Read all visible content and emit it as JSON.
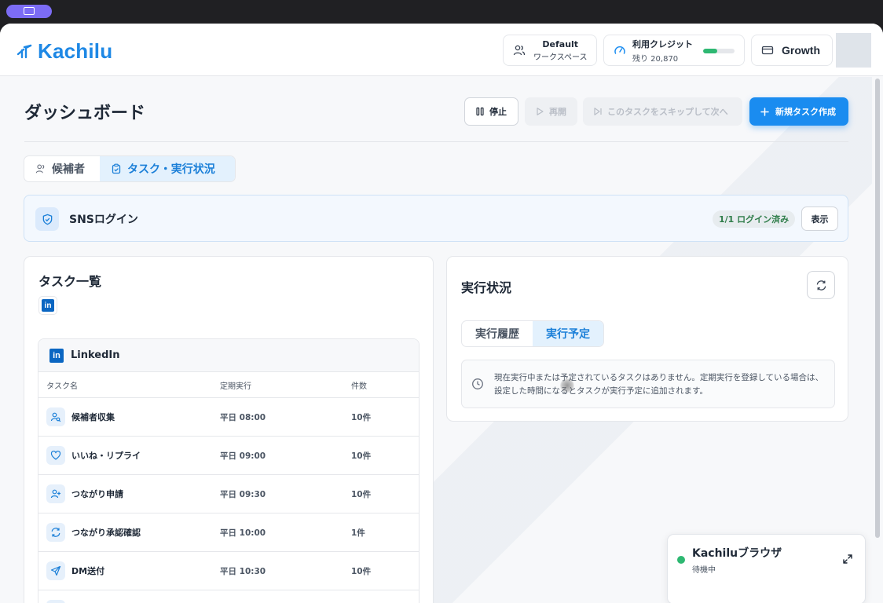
{
  "app": {
    "logo_text": "Kachilu"
  },
  "header": {
    "workspace": {
      "name": "Default",
      "sub": "ワークスペース"
    },
    "credits": {
      "label": "利用クレジット",
      "remaining": "残り 20,870",
      "fill_fraction": 0.45
    },
    "plan": {
      "label": "Growth"
    }
  },
  "page": {
    "title": "ダッシュボード",
    "actions": {
      "stop": "停止",
      "resume": "再開",
      "skip": "このタスクをスキップして次へ",
      "new_task": "新規タスク作成"
    }
  },
  "tabs": {
    "candidates": "候補者",
    "tasks": "タスク・実行状況"
  },
  "sns": {
    "title": "SNSログイン",
    "badge": "1/1 ログイン済み",
    "view": "表示"
  },
  "task_list": {
    "title": "タスク一覧",
    "platform": "LinkedIn",
    "columns": {
      "name": "タスク名",
      "schedule": "定期実行",
      "count": "件数"
    },
    "rows": [
      {
        "name": "候補者収集",
        "schedule": "平日 08:00",
        "count": "10件",
        "icon": "user-search-icon"
      },
      {
        "name": "いいね・リプライ",
        "schedule": "平日 09:00",
        "count": "10件",
        "icon": "heart-icon"
      },
      {
        "name": "つながり申請",
        "schedule": "平日 09:30",
        "count": "10件",
        "icon": "user-plus-icon"
      },
      {
        "name": "つながり承認確認",
        "schedule": "平日 10:00",
        "count": "1件",
        "icon": "refresh-icon"
      },
      {
        "name": "DM送付",
        "schedule": "平日 10:30",
        "count": "10件",
        "icon": "send-icon"
      }
    ]
  },
  "execution": {
    "title": "実行状況",
    "tabs": {
      "history": "実行履歴",
      "scheduled": "実行予定"
    },
    "empty_message": "現在実行中または予定されているタスクはありません。定期実行を登録している場合は、設定した時間になるとタスクが実行予定に追加されます。"
  },
  "browser": {
    "title": "Kachiluブラウザ",
    "status": "待機中"
  },
  "colors": {
    "accent": "#1a8cf0",
    "logo": "#1e88e5",
    "success": "#2eb872",
    "linkedin": "#0a66c2"
  }
}
